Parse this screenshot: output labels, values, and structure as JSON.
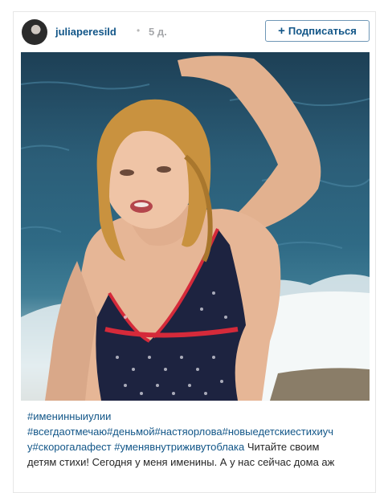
{
  "post": {
    "username": "juliaperesild",
    "separator": "•",
    "time": "5 д.",
    "follow_label": "Подписаться",
    "follow_icon": "plus-icon"
  },
  "caption": {
    "line1_tag": "#именинныиулии",
    "line2_tags": "#всегдаотмечаю#деньмой#настяорлова#новыедетскиестихиуч",
    "line3_tags": "у#скорогалафест #уменявнутриживутоблака",
    "line3_text": " Читайте своим",
    "line4_text": "детям стихи! Сегодня у меня именины. А у нас сейчас дома аж"
  }
}
